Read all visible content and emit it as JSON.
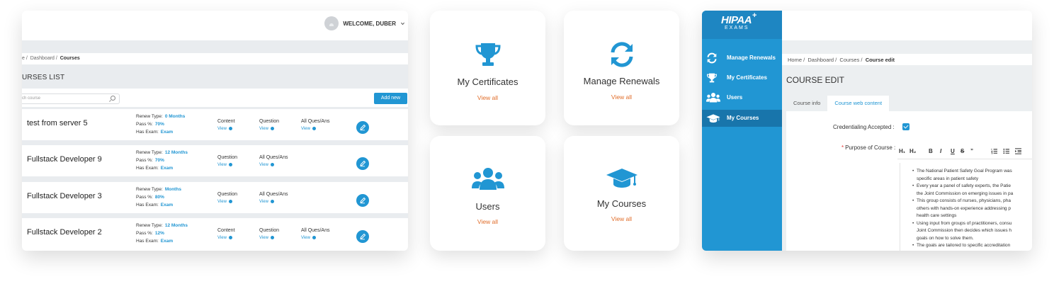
{
  "courses_list": {
    "welcome": "WELCOME, DUBER",
    "breadcrumb": [
      "e",
      "Dashboard",
      "Courses"
    ],
    "heading": "URSES LIST",
    "search_placeholder": "ch course",
    "add_button": "Add new",
    "labels": {
      "renew_type": "Renew Type:",
      "pass": "Pass %:",
      "has_exam": "Has Exam:",
      "content": "Content",
      "question": "Question",
      "all_ques": "All Ques/Ans",
      "view": "View"
    },
    "rows": [
      {
        "name": "test from server 5",
        "renew": "0 Months",
        "pass": "70%",
        "exam": "Exam",
        "cols": [
          "Content",
          "Question",
          "All Ques/Ans"
        ]
      },
      {
        "name": "Fullstack Developer 9",
        "renew": "12 Months",
        "pass": "70%",
        "exam": "Exam",
        "cols": [
          "Question",
          "All Ques/Ans"
        ]
      },
      {
        "name": "Fullstack Developer 3",
        "renew": "Months",
        "pass": "80%",
        "exam": "Exam",
        "cols": [
          "Question",
          "All Ques/Ans"
        ]
      },
      {
        "name": "Fullstack Developer 2",
        "renew": "12 Months",
        "pass": "12%",
        "exam": "Exam",
        "cols": [
          "Content",
          "Question",
          "All Ques/Ans"
        ]
      }
    ]
  },
  "tiles": [
    {
      "title": "My Certificates",
      "link": "View all",
      "icon": "trophy-icon"
    },
    {
      "title": "Manage Renewals",
      "link": "View all",
      "icon": "refresh-icon"
    },
    {
      "title": "Users",
      "link": "View all",
      "icon": "users-icon"
    },
    {
      "title": "My Courses",
      "link": "View all",
      "icon": "graduation-cap-icon"
    }
  ],
  "course_edit": {
    "logo_top": "HIPAA",
    "logo_bottom": "EXAMS",
    "sidebar": [
      {
        "label": "Manage Renewals",
        "icon": "refresh-icon"
      },
      {
        "label": "My Certificates",
        "icon": "trophy-icon"
      },
      {
        "label": "Users",
        "icon": "users-icon"
      },
      {
        "label": "My Courses",
        "icon": "graduation-cap-icon",
        "active": true
      }
    ],
    "breadcrumb": [
      "Home",
      "Dashboard",
      "Courses",
      "Course edit"
    ],
    "heading": "COURSE EDIT",
    "tabs": [
      "Course info",
      "Course web content"
    ],
    "credentialing_label": "Credentialing Accepted :",
    "purpose_label": "Purpose of Course :",
    "toolbar": [
      "H₁",
      "H₂",
      "B",
      "I",
      "U",
      "S",
      "”"
    ],
    "editor_lines": [
      {
        "text": "The National Patient Safety Goal Program was",
        "bullet": true
      },
      {
        "text": "specific areas in patient safety",
        "bullet": false
      },
      {
        "text": "Every year a panel of safety experts, the Patie",
        "bullet": true
      },
      {
        "text": "the Joint Commission on emerging issues in pa",
        "bullet": false
      },
      {
        "text": "This group consists of nurses, physicians, pha",
        "bullet": true
      },
      {
        "text": "others with hands-on experience addressing p",
        "bullet": false
      },
      {
        "text": "health care settings",
        "bullet": false
      },
      {
        "text": "Using input from groups of practitioners, consu",
        "bullet": true
      },
      {
        "text": "Joint Commission then decides which issues h",
        "bullet": false
      },
      {
        "text": "goals on how to solve them.",
        "bullet": false
      },
      {
        "text": "The goals are tailored to specific accreditation",
        "bullet": true
      }
    ],
    "colors": {
      "primary": "#2196d3",
      "sidebar_active": "#1875ab",
      "link_orange": "#e06d2a"
    }
  }
}
